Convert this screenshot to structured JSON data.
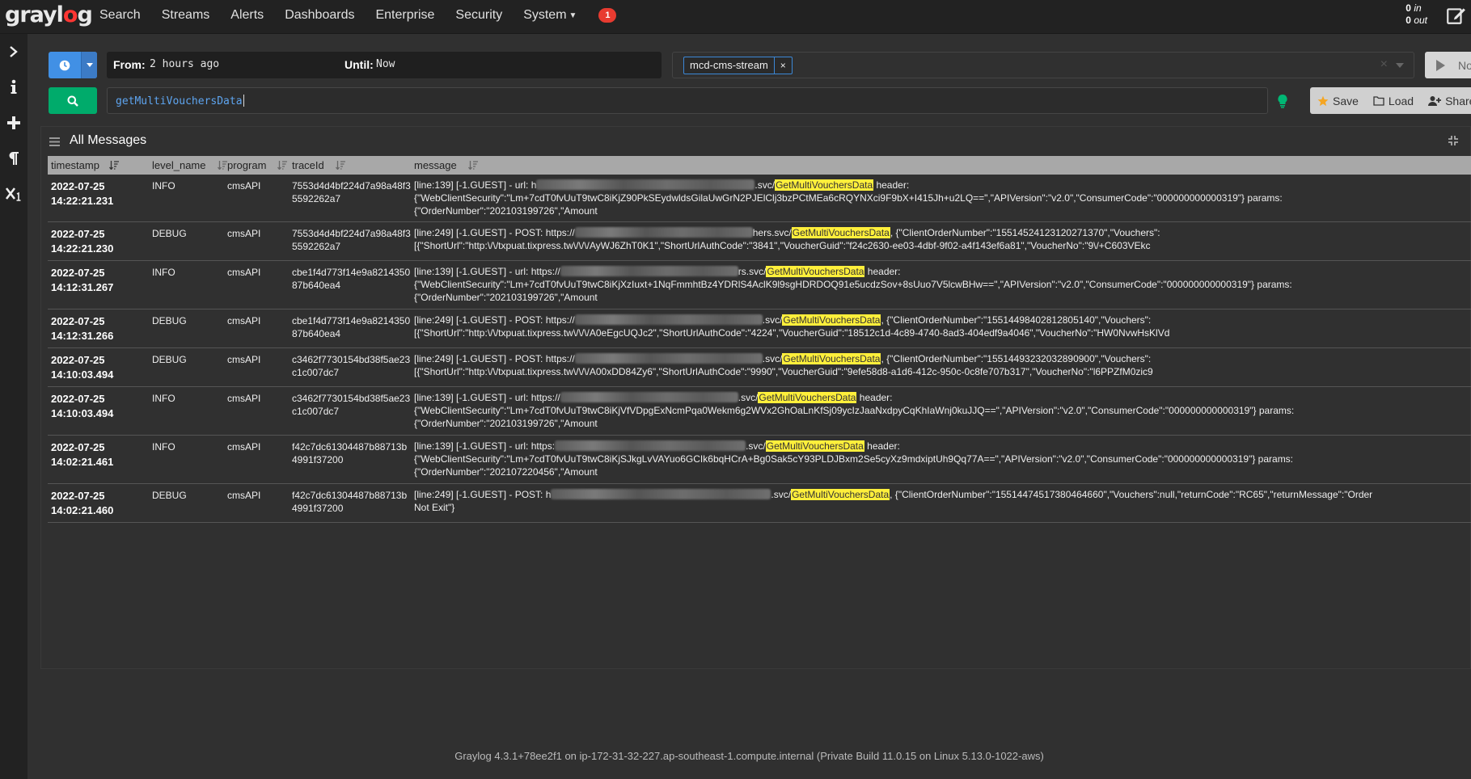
{
  "nav": {
    "logo": "graylog",
    "items": [
      "Search",
      "Streams",
      "Alerts",
      "Dashboards",
      "Enterprise",
      "Security"
    ],
    "system_label": "System",
    "notifications": "1",
    "throughput_in_value": "0",
    "throughput_in_label": "in",
    "throughput_out_value": "0",
    "throughput_out_label": "out"
  },
  "search": {
    "from_label": "From:",
    "from_value": "2 hours ago",
    "until_label": "Until:",
    "until_value": "Now",
    "stream_tag": "mcd-cms-stream",
    "stream_tag_remove": "×",
    "clear_symbol": "×",
    "refresh_label": "Not updating",
    "query": "getMultiVouchersData",
    "save_label": "Save",
    "load_label": "Load",
    "share_label": "Share"
  },
  "widget": {
    "title": "All Messages",
    "columns": [
      "timestamp",
      "level_name",
      "program",
      "traceId",
      "message"
    ]
  },
  "rows": [
    {
      "date": "2022-07-25",
      "time": "14:22:21.231",
      "level": "INFO",
      "program": "cmsAPI",
      "trace": "7553d4d4bf224d7a98a48f35592262a7",
      "msg_pre": "[line:139] [-1.GUEST] - url: h",
      "blur_w": 270,
      "msg_mid": ".svc/",
      "highlight": "GetMultiVouchersData",
      "msg_post": " header:",
      "msg_line2": "{\"WebClientSecurity\":\"Lm+7cdT0fvUuT9twC8iKjZ90PkSEydwldsGilaUwGrN2PJElClj3bzPCtMEa6cRQYNXci9F9bX+I415Jh+u2LQ==\",\"APIVersion\":\"v2.0\",\"ConsumerCode\":\"000000000000319\"} params:",
      "msg_line3": "{\"OrderNumber\":\"202103199726\",\"Amount"
    },
    {
      "date": "2022-07-25",
      "time": "14:22:21.230",
      "level": "DEBUG",
      "program": "cmsAPI",
      "trace": "7553d4d4bf224d7a98a48f35592262a7",
      "msg_pre": "[line:249] [-1.GUEST] - POST: https://",
      "blur_w": 220,
      "msg_mid": "hers.svc/",
      "highlight": "GetMultiVouchersData",
      "msg_post": ", {\"ClientOrderNumber\":\"15514524123120271370\",\"Vouchers\":",
      "msg_line2": "[{\"ShortUrl\":\"http:\\/\\/txpuat.tixpress.tw\\/\\/\\/AyWJ6ZhT0K1\",\"ShortUrlAuthCode\":\"3841\",\"VoucherGuid\":\"f24c2630-ee03-4dbf-9f02-a4f143ef6a81\",\"VoucherNo\":\"9\\/+C603VEkc",
      "msg_line3": ""
    },
    {
      "date": "2022-07-25",
      "time": "14:12:31.267",
      "level": "INFO",
      "program": "cmsAPI",
      "trace": "cbe1f4d773f14e9a821435087b640ea4",
      "msg_pre": "[line:139] [-1.GUEST] - url: https://",
      "blur_w": 220,
      "msg_mid": "rs.svc/",
      "highlight": "GetMultiVouchersData",
      "msg_post": " header:",
      "msg_line2": "{\"WebClientSecurity\":\"Lm+7cdT0fvUuT9twC8iKjXzIuxt+1NqFmmhtBz4YDRlS4AclK9l9sgHDRDOQ91e5ucdzSov+8sUuo7V5lcwBHw==\",\"APIVersion\":\"v2.0\",\"ConsumerCode\":\"000000000000319\"} params:",
      "msg_line3": "{\"OrderNumber\":\"202103199726\",\"Amount"
    },
    {
      "date": "2022-07-25",
      "time": "14:12:31.266",
      "level": "DEBUG",
      "program": "cmsAPI",
      "trace": "cbe1f4d773f14e9a821435087b640ea4",
      "msg_pre": "[line:249] [-1.GUEST] - POST: https://",
      "blur_w": 232,
      "msg_mid": ".svc/",
      "highlight": "GetMultiVouchersData",
      "msg_post": ", {\"ClientOrderNumber\":\"15514498402812805140\",\"Vouchers\":",
      "msg_line2": "[{\"ShortUrl\":\"http:\\/\\/txpuat.tixpress.tw\\/\\/\\/A0eEgcUQJc2\",\"ShortUrlAuthCode\":\"4224\",\"VoucherGuid\":\"18512c1d-4c89-4740-8ad3-404edf9a4046\",\"VoucherNo\":\"HW0NvwHsKlVd",
      "msg_line3": ""
    },
    {
      "date": "2022-07-25",
      "time": "14:10:03.494",
      "level": "DEBUG",
      "program": "cmsAPI",
      "trace": "c3462f7730154bd38f5ae23c1c007dc7",
      "msg_pre": "[line:249] [-1.GUEST] - POST: https://",
      "blur_w": 232,
      "msg_mid": ".svc/",
      "highlight": "GetMultiVouchersData",
      "msg_post": ", {\"ClientOrderNumber\":\"15514493232032890900\",\"Vouchers\":",
      "msg_line2": "[{\"ShortUrl\":\"http:\\/\\/txpuat.tixpress.tw\\/\\/\\/A00xDD84Zy6\",\"ShortUrlAuthCode\":\"9990\",\"VoucherGuid\":\"9efe58d8-a1d6-412c-950c-0c8fe707b317\",\"VoucherNo\":\"l6PPZfM0zic9",
      "msg_line3": ""
    },
    {
      "date": "2022-07-25",
      "time": "14:10:03.494",
      "level": "INFO",
      "program": "cmsAPI",
      "trace": "c3462f7730154bd38f5ae23c1c007dc7",
      "msg_pre": "[line:139] [-1.GUEST] - url: https://",
      "blur_w": 220,
      "msg_mid": ".svc/",
      "highlight": "GetMultiVouchersData",
      "msg_post": " header:",
      "msg_line2": "{\"WebClientSecurity\":\"Lm+7cdT0fvUuT9twC8iKjVfVDpgExNcmPqa0Wekm6g2WVx2GhOaLnKfSj09ycIzJaaNxdpyCqKhIaWnj0kuJJQ==\",\"APIVersion\":\"v2.0\",\"ConsumerCode\":\"000000000000319\"} params:",
      "msg_line3": "{\"OrderNumber\":\"202103199726\",\"Amount"
    },
    {
      "date": "2022-07-25",
      "time": "14:02:21.461",
      "level": "INFO",
      "program": "cmsAPI",
      "trace": "f42c7dc61304487b88713b4991f37200",
      "msg_pre": "[line:139] [-1.GUEST] - url: https:",
      "blur_w": 236,
      "msg_mid": ".svc/",
      "highlight": "GetMultiVouchersData",
      "msg_post": " header:",
      "msg_line2": "{\"WebClientSecurity\":\"Lm+7cdT0fvUuT9twC8iKjSJkgLvVAYuo6GCIk6bqHCrA+Bg0Sak5cY93PLDJBxm2Se5cyXz9mdxiptUh9Qq77A==\",\"APIVersion\":\"v2.0\",\"ConsumerCode\":\"000000000000319\"} params:",
      "msg_line3": "{\"OrderNumber\":\"202107220456\",\"Amount"
    },
    {
      "date": "2022-07-25",
      "time": "14:02:21.460",
      "level": "DEBUG",
      "program": "cmsAPI",
      "trace": "f42c7dc61304487b88713b4991f37200",
      "msg_pre": "[line:249] [-1.GUEST] - POST: h",
      "blur_w": 272,
      "msg_mid": ".svc/",
      "highlight": "GetMultiVouchersData",
      "msg_post": ", {\"ClientOrderNumber\":\"15514474517380464660\",\"Vouchers\":null,\"returnCode\":\"RC65\",\"returnMessage\":\"Order",
      "msg_line2": "Not Exit\"}",
      "msg_line3": ""
    }
  ],
  "footer": "Graylog 4.3.1+78ee2f1 on ip-172-31-32-227.ap-southeast-1.compute.internal (Private Build 11.0.15 on Linux 5.13.0-1022-aws)"
}
